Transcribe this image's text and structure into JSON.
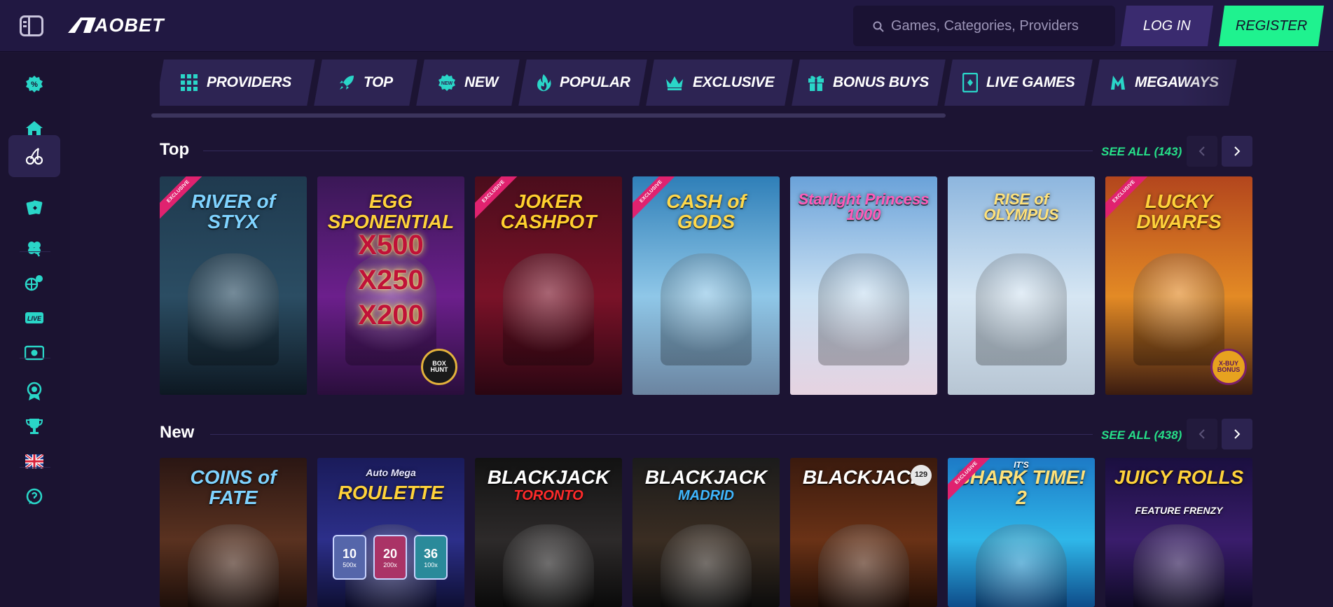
{
  "header": {
    "brand": "AOBET",
    "search_placeholder": "Games, Categories, Providers",
    "login_label": "LOG IN",
    "register_label": "REGISTER",
    "colors": {
      "accent": "#1ff28f",
      "bg": "#211842"
    }
  },
  "sidebar": {
    "items": [
      {
        "icon": "promotions-icon",
        "active": false
      },
      {
        "icon": "home-icon",
        "active": false
      },
      {
        "icon": "cherries-icon",
        "active": true
      },
      {
        "icon": "cards-icon",
        "active": false
      },
      {
        "icon": "clover-icon",
        "active": false
      },
      {
        "icon": "sports-icon",
        "active": false
      },
      {
        "icon": "live-icon",
        "active": false
      },
      {
        "icon": "esports-icon",
        "active": false
      },
      {
        "icon": "vip-badge-icon",
        "active": false
      },
      {
        "icon": "trophy-icon",
        "active": false
      },
      {
        "icon": "uk-flag-icon",
        "active": false
      },
      {
        "icon": "support-icon",
        "active": false
      }
    ]
  },
  "categories": [
    {
      "label": "PROVIDERS",
      "icon": "grid-icon"
    },
    {
      "label": "TOP",
      "icon": "rocket-icon"
    },
    {
      "label": "NEW",
      "icon": "new-badge-icon"
    },
    {
      "label": "POPULAR",
      "icon": "flame-icon"
    },
    {
      "label": "EXCLUSIVE",
      "icon": "crown-icon"
    },
    {
      "label": "BONUS BUYS",
      "icon": "gift-icon"
    },
    {
      "label": "LIVE GAMES",
      "icon": "live-card-icon"
    },
    {
      "label": "MEGAWAYS",
      "icon": "megaways-icon"
    }
  ],
  "sections": [
    {
      "title": "Top",
      "see_all": "SEE ALL (143)",
      "games": [
        {
          "title": "RIVER of STYX",
          "ribbon": "EXCLUSIVE",
          "colors": [
            "#1f3a4f",
            "#2b4d63",
            "#0d1822"
          ]
        },
        {
          "title": "EGG SPONENTIAL",
          "lines": [
            "X500",
            "X250",
            "X200"
          ],
          "badge": "BOX HUNT",
          "colors": [
            "#3a1856",
            "#6c1f8c",
            "#2a0e3c"
          ]
        },
        {
          "title": "JOKER CASHPOT",
          "ribbon": "EXCLUSIVE",
          "colors": [
            "#4b0d1c",
            "#7a1228",
            "#2a0612"
          ]
        },
        {
          "title": "CASH of GODS",
          "ribbon": "EXCLUSIVE",
          "colors": [
            "#2f7fb8",
            "#8fc7e8",
            "#6b84a0"
          ]
        },
        {
          "title": "Starlight Princess 1000",
          "colors": [
            "#6aa2d9",
            "#cbe1f3",
            "#e6d3e1"
          ]
        },
        {
          "title": "RISE of OLYMPUS",
          "colors": [
            "#8db6de",
            "#d6e6f3",
            "#b7c5d3"
          ]
        },
        {
          "title": "LUCKY DWARFS",
          "ribbon": "EXCLUSIVE",
          "badge": "X-BUY BONUS",
          "colors": [
            "#b3461d",
            "#e38a25",
            "#3b1c10"
          ]
        }
      ]
    },
    {
      "title": "New",
      "see_all": "SEE ALL (438)",
      "games": [
        {
          "title": "COINS of FATE",
          "colors": [
            "#2a1613",
            "#5a3220",
            "#1e0f0a"
          ]
        },
        {
          "title": "ROULETTE",
          "subtitle": "Auto Mega",
          "chips": [
            "10",
            "20",
            "36"
          ],
          "chip_labels": [
            "500x",
            "200x",
            "100x"
          ],
          "colors": [
            "#1a1b5a",
            "#2c2f8a",
            "#0e0f33"
          ]
        },
        {
          "title": "BLACKJACK",
          "subtitle": "TORONTO",
          "colors": [
            "#121212",
            "#2d2a2a",
            "#0a0a0a"
          ]
        },
        {
          "title": "BLACKJACK",
          "subtitle": "MADRID",
          "colors": [
            "#1b1b1b",
            "#3a2d22",
            "#0c0c0c"
          ]
        },
        {
          "title": "BLACKJACK",
          "badge": "129",
          "colors": [
            "#3a1a0e",
            "#6a3216",
            "#1f0d06"
          ]
        },
        {
          "title": "SHARK TIME! 2",
          "subtitle": "IT'S",
          "ribbon": "EXCLUSIVE",
          "colors": [
            "#1d7ac6",
            "#2fb7e9",
            "#0e4c8a"
          ]
        },
        {
          "title": "JUICY ROLLS",
          "subtitle": "FEATURE FRENZY",
          "colors": [
            "#1a0f3f",
            "#3a1d6c",
            "#0f0a26"
          ]
        }
      ]
    }
  ]
}
